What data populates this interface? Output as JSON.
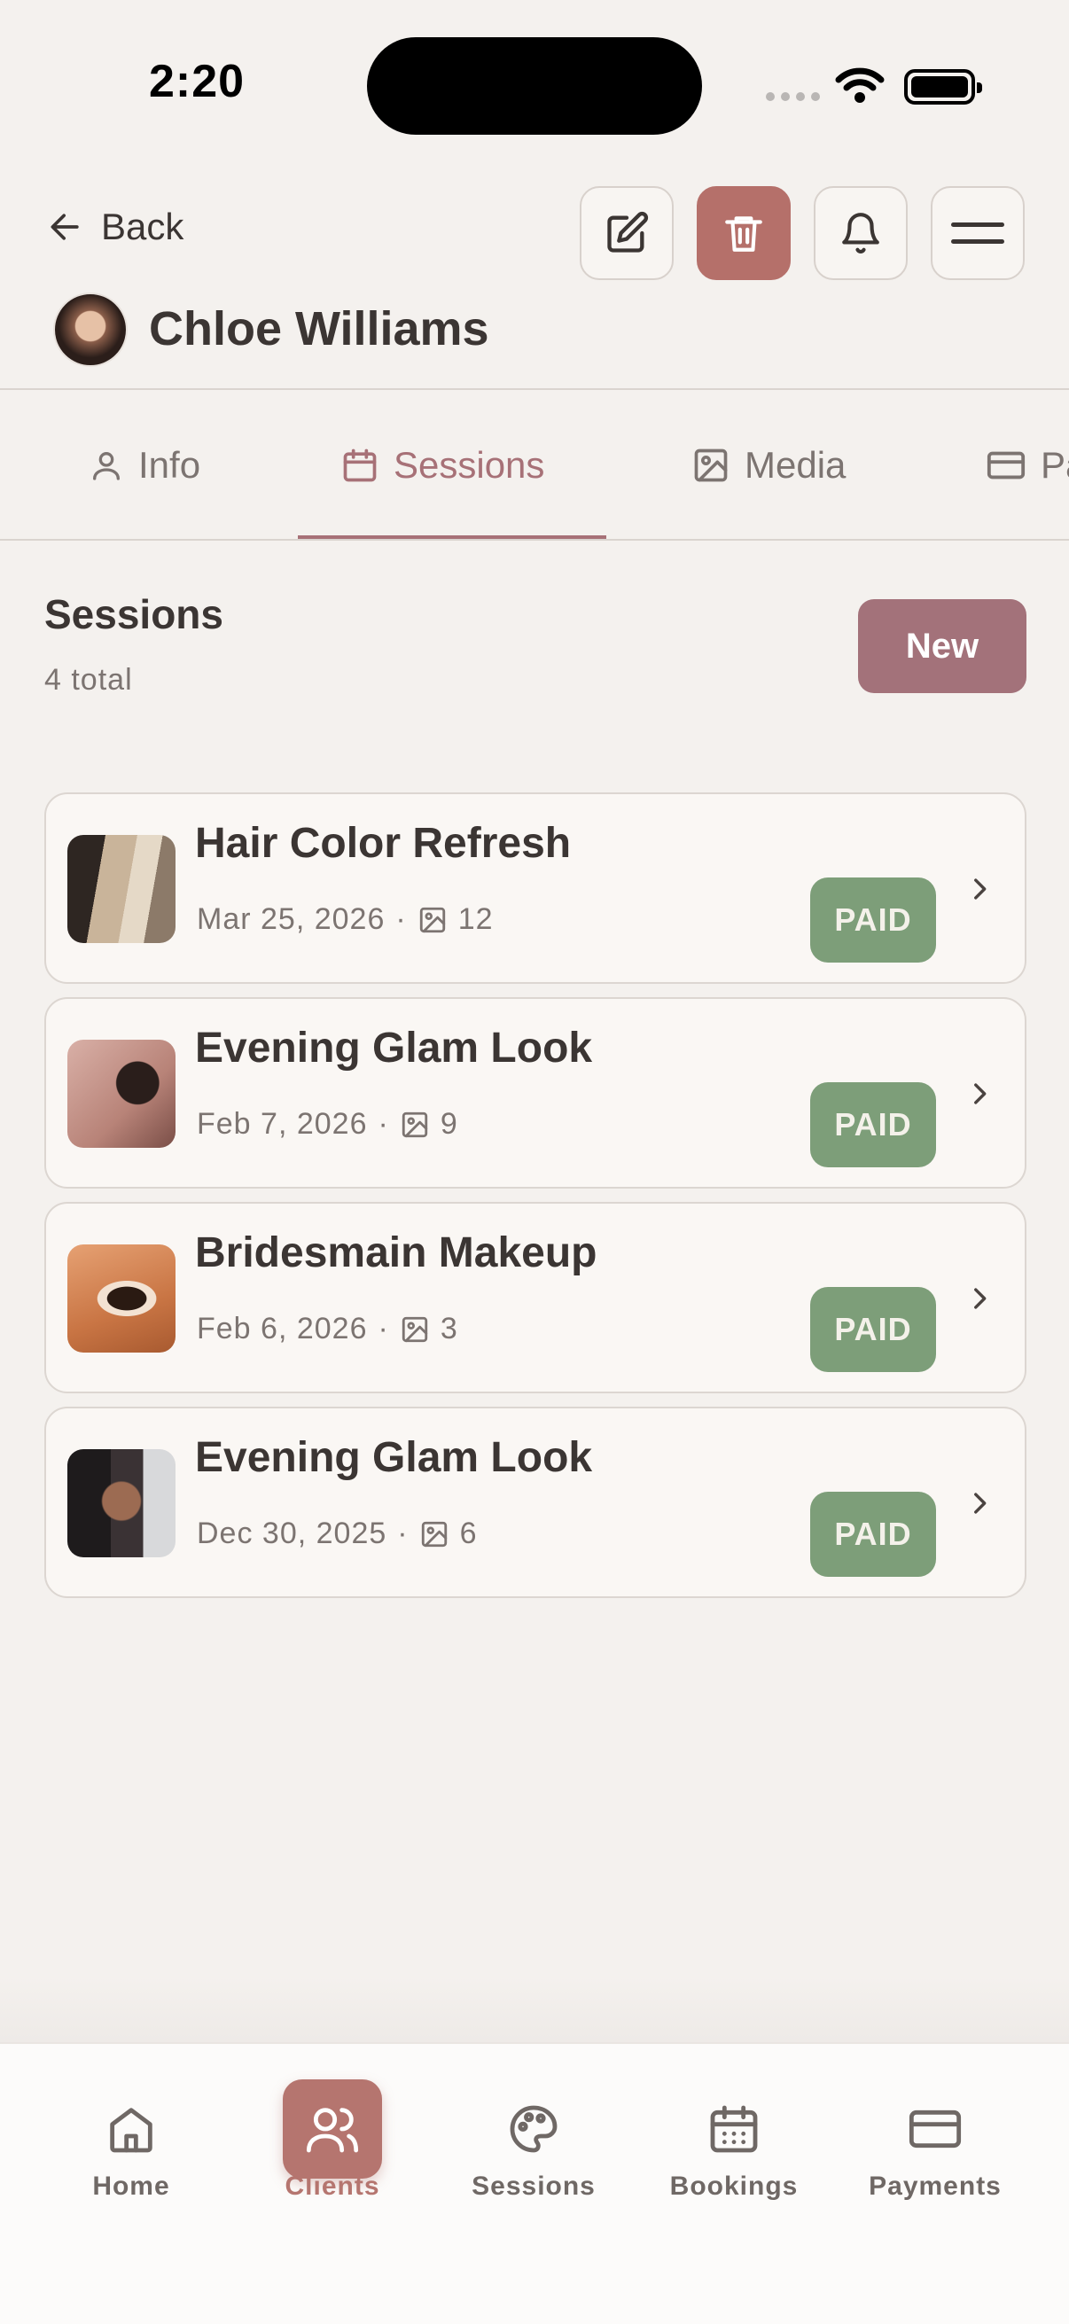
{
  "status_bar": {
    "time": "2:20"
  },
  "header": {
    "back_label": "Back",
    "client_name": "Chloe Williams",
    "actions": [
      "edit-icon",
      "trash-icon",
      "bell-icon",
      "menu-icon"
    ],
    "accent_color": "#B5706A"
  },
  "tabs": [
    {
      "label": "Info",
      "icon": "user-icon",
      "active": false
    },
    {
      "label": "Sessions",
      "icon": "calendar-icon",
      "active": true
    },
    {
      "label": "Media",
      "icon": "image-icon",
      "active": false
    },
    {
      "label": "Pa",
      "icon": "card-icon",
      "active": false
    }
  ],
  "sessions": {
    "title": "Sessions",
    "subtitle": "4 total",
    "new_label": "New",
    "items": [
      {
        "title": "Hair Color Refresh",
        "date": "Mar 25, 2026",
        "media_count": "12",
        "status": "PAID"
      },
      {
        "title": "Evening Glam Look",
        "date": "Feb 7, 2026",
        "media_count": "9",
        "status": "PAID"
      },
      {
        "title": "Bridesmain Makeup",
        "date": "Feb 6, 2026",
        "media_count": "3",
        "status": "PAID"
      },
      {
        "title": "Evening Glam Look",
        "date": "Dec 30, 2025",
        "media_count": "6",
        "status": "PAID"
      }
    ],
    "status_color": "#7D9E79"
  },
  "bottom_nav": [
    {
      "label": "Home",
      "icon": "home-icon",
      "active": false
    },
    {
      "label": "Clients",
      "icon": "users-icon",
      "active": true
    },
    {
      "label": "Sessions",
      "icon": "palette-icon",
      "active": false
    },
    {
      "label": "Bookings",
      "icon": "calendar-icon",
      "active": false
    },
    {
      "label": "Payments",
      "icon": "card-icon",
      "active": false
    }
  ]
}
